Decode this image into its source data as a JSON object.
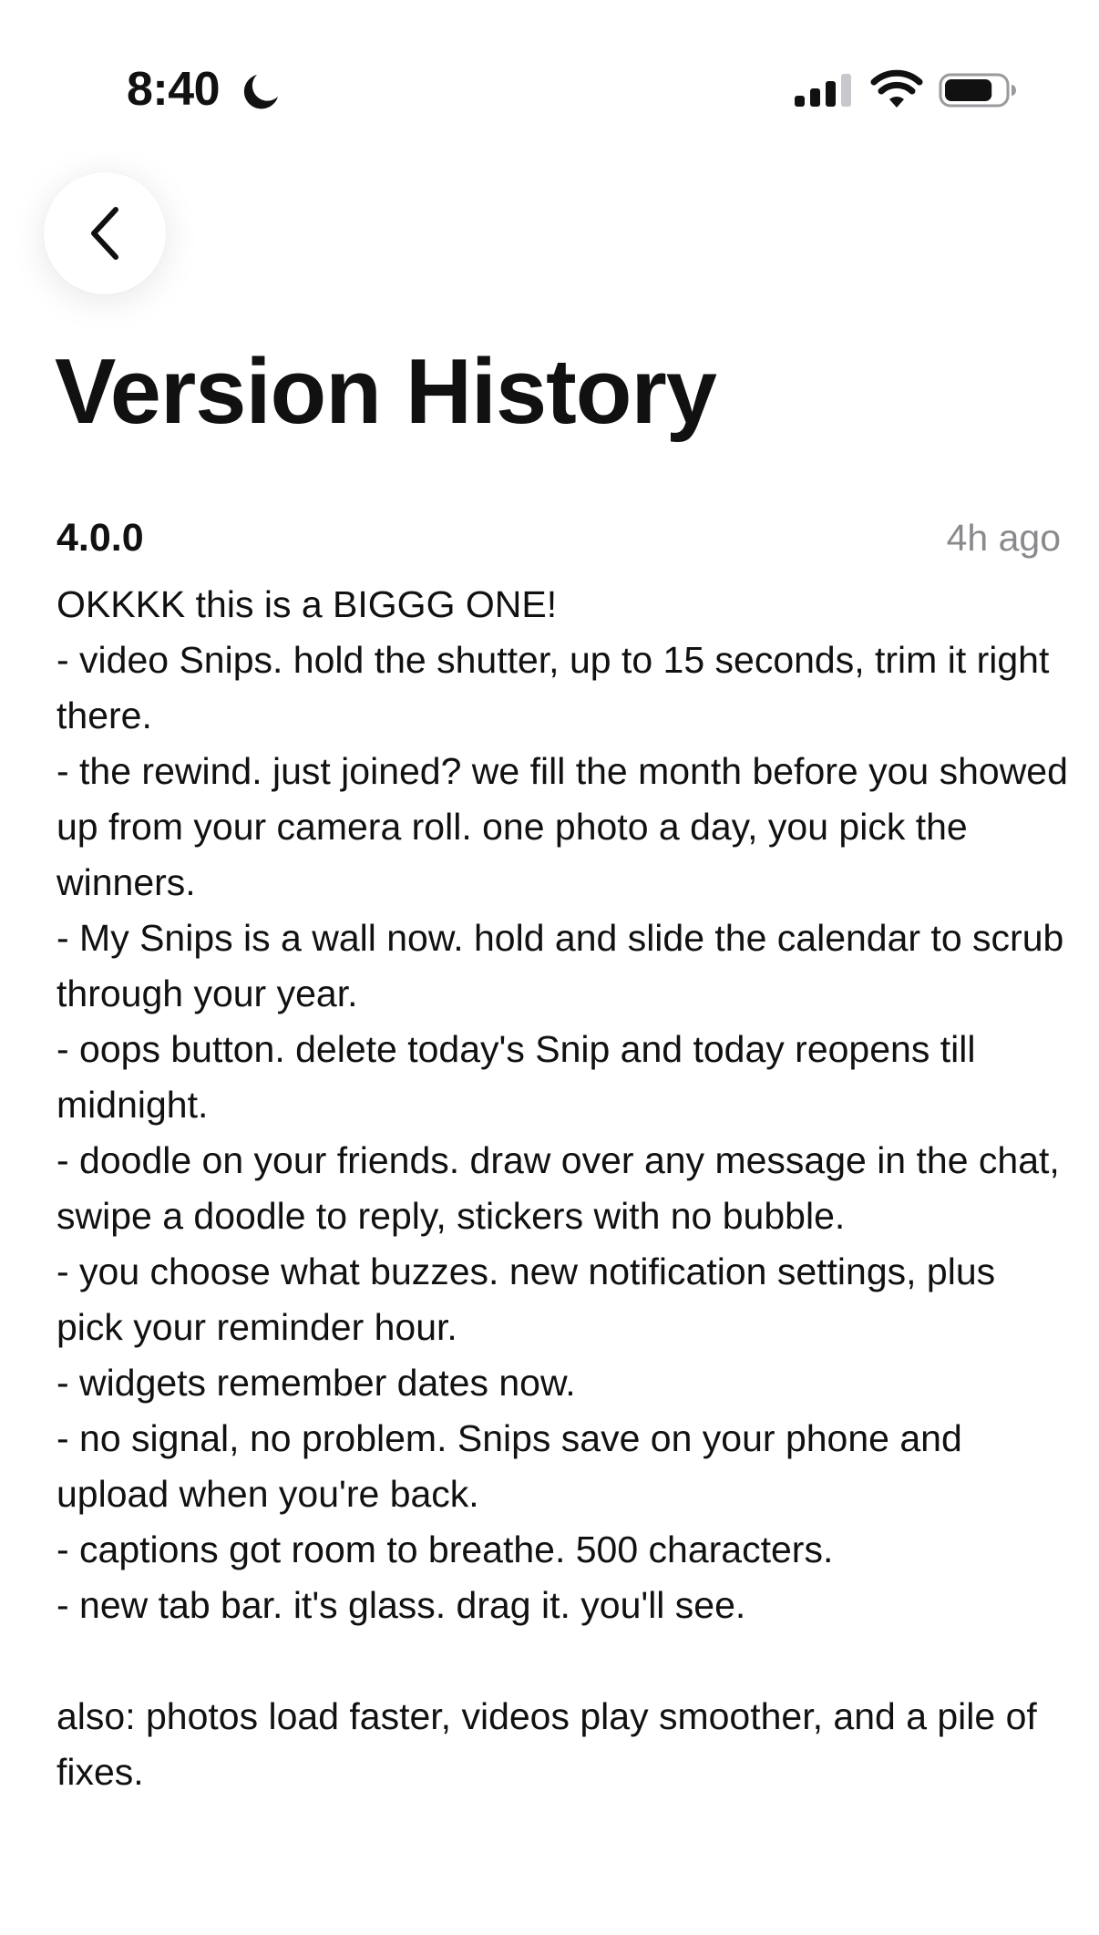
{
  "status_bar": {
    "time": "8:40",
    "icons": [
      "moon-icon",
      "cellular-signal-icon",
      "wifi-icon",
      "battery-icon"
    ],
    "battery_level": 0.8
  },
  "header": {
    "back_icon": "chevron-left-icon",
    "title": "Version History"
  },
  "release": {
    "version": "4.0.0",
    "time_ago": "4h ago",
    "lines": [
      "OKKKK this is a BIGGG ONE!",
      "- video Snips. hold the shutter, up to 15 seconds, trim it right there.",
      "- the rewind. just joined? we fill the month before you showed up from your camera roll. one photo a day, you pick the winners.",
      "- My Snips is a wall now. hold and slide the calendar to scrub through your year.",
      "- oops button. delete today's Snip and today reopens till midnight.",
      "- doodle on your friends. draw over any message in the chat, swipe a doodle to reply, stickers with no bubble.",
      "- you choose what buzzes. new notification settings, plus pick your reminder hour.",
      "- widgets remember dates now.",
      "- no signal, no problem. Snips save on your phone and upload when you're back.",
      "- captions got room to breathe. 500 characters.",
      "- new tab bar. it's glass. drag it. you'll see."
    ],
    "footer": "also: photos load faster, videos play smoother, and a pile of fixes."
  }
}
